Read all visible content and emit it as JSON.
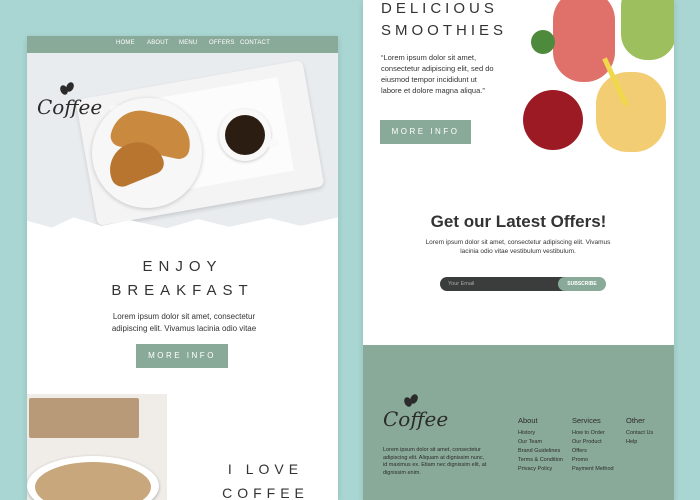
{
  "left_page": {
    "nav": [
      "HOME",
      "ABOUT",
      "MENU",
      "OFFERS",
      "CONTACT"
    ],
    "logo_text": "Coffee",
    "heading_line1": "ENJOY",
    "heading_line2": "BREAKFAST",
    "body": "Lorem ipsum dolor sit amet, consectetur adipiscing elit. Vivamus lacinia odio vitae",
    "button_label": "MORE INFO",
    "heading2_line1": "I LOVE",
    "heading2_line2": "COFFEE"
  },
  "right_page": {
    "heading_line1": "DELICIOUS",
    "heading_line2": "SMOOTHIES",
    "body": "“Lorem ipsum dolor sit amet, consectetur adipiscing elit, sed do eiusmod tempor incididunt ut labore et dolore magna aliqua.”",
    "button_label": "MORE INFO",
    "offers_title": "Get our Latest Offers!",
    "offers_body": "Lorem ipsum dolor sit amet, consectetur adipiscing elit. Vivamus lacinia odio vitae vestibulum vestibulum.",
    "email_placeholder": "Your Email",
    "subscribe_label": "SUBSCRIBE",
    "footer": {
      "logo_text": "Coffee",
      "body": "Lorem ipsum dolor sit amet, consectetur adipiscing elit. Aliquam at dignissim nunc, id maximus ex. Etiam nec dignissim elit, at dignissim enim.",
      "columns": [
        {
          "heading": "About",
          "links": [
            "History",
            "Our Team",
            "Brand Guidelines",
            "Terms & Condition",
            "Privacy Policy"
          ]
        },
        {
          "heading": "Services",
          "links": [
            "How to Order",
            "Our Product",
            "Offers",
            "Promo",
            "Payment Method"
          ]
        },
        {
          "heading": "Other",
          "links": [
            "Contact Us",
            "Help"
          ]
        }
      ]
    }
  },
  "colors": {
    "background": "#a9d6d2",
    "accent_green": "#8aaa99",
    "dark_text": "#333333",
    "email_input": "#3a3d3c"
  },
  "icons": [
    "coffee-beans-icon"
  ]
}
